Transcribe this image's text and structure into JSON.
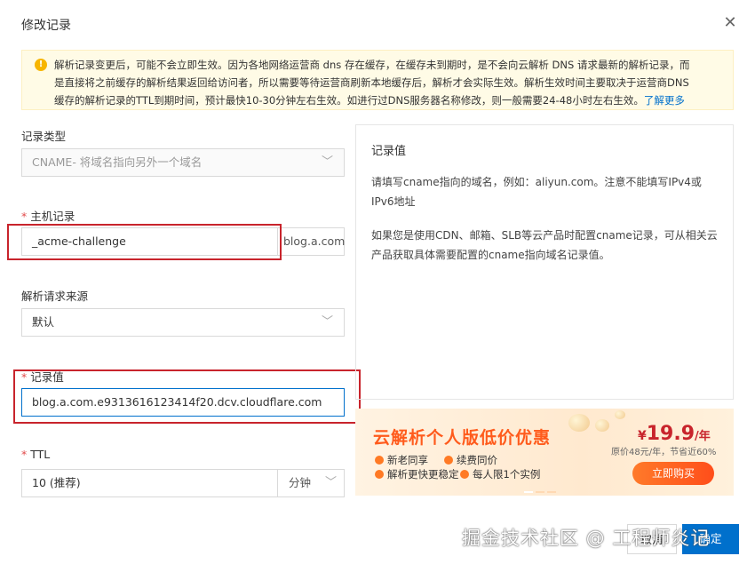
{
  "dialog": {
    "title": "修改记录"
  },
  "notice": {
    "line1": "解析记录变更后，可能不会立即生效。因为各地网络运营商 dns 存在缓存，在缓存未到期时，是不会向云解析 DNS 请求最新的解析记录，而",
    "line2": "是直接将之前缓存的解析结果返回给访问者，所以需要等待运营商刷新本地缓存后，解析才会实际生效。解析生效时间主要取决于运营商DNS",
    "line3": "缓存的解析记录的TTL到期时间，预计最快10-30分钟左右生效。如进行过DNS服务器名称修改，则一般需要24-48小时左右生效。",
    "link": "了解更多"
  },
  "form": {
    "record_type": {
      "label": "记录类型",
      "value": "CNAME- 将域名指向另外一个域名"
    },
    "host": {
      "label": "主机记录",
      "value": "_acme-challenge",
      "suffix": "blog.a.com"
    },
    "source": {
      "label": "解析请求来源",
      "value": "默认"
    },
    "record_value": {
      "label": "记录值",
      "value": "blog.a.com.e9313616123414f20.dcv.cloudflare.com"
    },
    "ttl": {
      "label": "TTL",
      "value": "10 (推荐)",
      "unit": "分钟"
    },
    "required_mark": "*"
  },
  "help": {
    "title": "记录值",
    "p1": "请填写cname指向的域名，例如：aliyun.com。注意不能填写IPv4或IPv6地址",
    "p2": "如果您是使用CDN、邮箱、SLB等云产品时配置cname记录，可从相关云产品获取具体需要配置的cname指向域名记录值。"
  },
  "promo": {
    "title": "云解析个人版低价优惠",
    "features": [
      "新老同享",
      "续费同价",
      "解析更快更稳定",
      "每人限1个实例"
    ],
    "currency": "¥",
    "price": "19.9",
    "per": "/年",
    "original": "原价48元/年，节省近60%",
    "buy": "立即购买"
  },
  "footer": {
    "watermark": "掘金技术社区 @ 工程师炎记",
    "cancel": "取消",
    "ok": "确定"
  },
  "colors": {
    "primary": "#0070cc",
    "highlight": "#c8242c",
    "promo": "#ff5b1c"
  }
}
